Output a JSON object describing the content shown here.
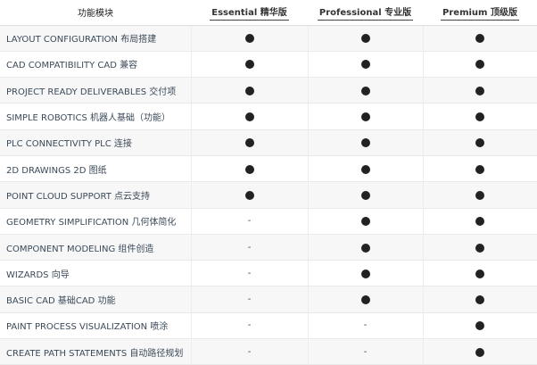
{
  "header": {
    "module_label": "功能模块",
    "tiers": [
      {
        "label": "Essential 精华版"
      },
      {
        "label": "Professional 专业版"
      },
      {
        "label": "Premium 顶级版"
      }
    ]
  },
  "symbols": {
    "included_icon": "filled-circle",
    "excluded_text": "-",
    "dot_color": "#222222"
  },
  "rows": [
    {
      "feature": "LAYOUT CONFIGURATION 布局搭建",
      "cells": [
        "dot",
        "dot",
        "dot"
      ]
    },
    {
      "feature": "CAD COMPATIBILITY  CAD 兼容",
      "cells": [
        "dot",
        "dot",
        "dot"
      ]
    },
    {
      "feature": "PROJECT READY  DELIVERABLES 交付项",
      "cells": [
        "dot",
        "dot",
        "dot"
      ]
    },
    {
      "feature": "SIMPLE ROBOTICS  机器人基础（功能）",
      "cells": [
        "dot",
        "dot",
        "dot"
      ]
    },
    {
      "feature": "PLC CONNECTIVITY PLC 连接",
      "cells": [
        "dot",
        "dot",
        "dot"
      ]
    },
    {
      "feature": "2D DRAWINGS 2D 图纸",
      "cells": [
        "dot",
        "dot",
        "dot"
      ]
    },
    {
      "feature": "POINT CLOUD SUPPORT 点云支持",
      "cells": [
        "dot",
        "dot",
        "dot"
      ]
    },
    {
      "feature": "GEOMETRY SIMPLIFICATION 几何体简化",
      "cells": [
        "-",
        "dot",
        "dot"
      ]
    },
    {
      "feature": "COMPONENT MODELING 组件创造",
      "cells": [
        "-",
        "dot",
        "dot"
      ]
    },
    {
      "feature": "WIZARDS 向导",
      "cells": [
        "-",
        "dot",
        "dot"
      ]
    },
    {
      "feature": "BASIC CAD 基础CAD 功能",
      "cells": [
        "-",
        "dot",
        "dot"
      ]
    },
    {
      "feature": "PAINT PROCESS VISUALIZATION 喷涂",
      "cells": [
        "-",
        "-",
        "dot"
      ]
    },
    {
      "feature": "CREATE PATH STATEMENTS 自动路径规划",
      "cells": [
        "-",
        "-",
        "dot"
      ]
    }
  ]
}
